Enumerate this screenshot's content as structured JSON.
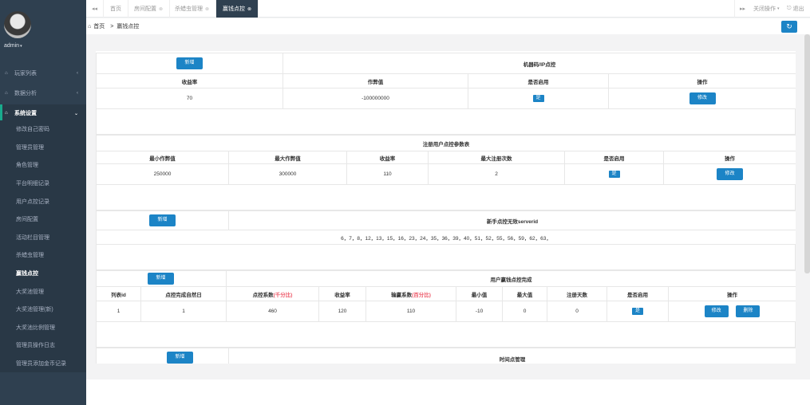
{
  "sidebar": {
    "username": "admin",
    "menus": [
      {
        "icon": "home-icon",
        "label": "玩家列表"
      },
      {
        "icon": "home-icon",
        "label": "数据分析"
      },
      {
        "icon": "home-icon",
        "label": "系统设置"
      }
    ],
    "submenu": [
      "修改自己密码",
      "管理员管理",
      "角色管理",
      "平台明细记录",
      "用户点控记录",
      "房间配置",
      "活动栏目管理",
      "杀蜡虫管理",
      "赢钱点控",
      "大奖池管理",
      "大奖池管理(新)",
      "大奖池比例管理",
      "管理员操作日志",
      "管理员添加金币记录"
    ]
  },
  "tabs": {
    "items": [
      "首页",
      "房间配置",
      "杀蜡虫管理",
      "赢钱点控"
    ],
    "close_ops": "关闭操作",
    "logout": "退出"
  },
  "breadcrumb": {
    "home": "首页",
    "sep": ">",
    "current": "赢钱点控"
  },
  "section1": {
    "add": "新增",
    "title": "机器码/IP点控",
    "headers": [
      "收益率",
      "作弊值",
      "是否启用",
      "操作"
    ],
    "row": {
      "rate": "70",
      "cheat": "-100000000",
      "enabled": "是",
      "edit": "修改"
    }
  },
  "section2": {
    "title": "注册用户点控参数表",
    "headers": [
      "最小作弊值",
      "最大作弊值",
      "收益率",
      "最大注册次数",
      "是否启用",
      "操作"
    ],
    "row": {
      "min": "250000",
      "max": "300000",
      "rate": "110",
      "max_reg": "2",
      "enabled": "是",
      "edit": "修改"
    }
  },
  "section3": {
    "add": "新增",
    "title": "新手点控无效serverid",
    "ids": "6，7，8，12，13，15，16，23，24，35，36，39，40，51，52，55，56，59，62，63，"
  },
  "section4": {
    "add": "新增",
    "title": "用户赢钱点控完成",
    "headers": {
      "id": "列表id",
      "days": "点控完成自然日",
      "ratio": "点控系数",
      "ratio_unit": "(千分比)",
      "rate": "收益率",
      "win": "输赢系数",
      "win_unit": "(百分比)",
      "min": "最小值",
      "max": "最大值",
      "reg_days": "注册天数",
      "enabled": "是否启用",
      "op": "操作"
    },
    "row": {
      "id": "1",
      "days": "1",
      "ratio": "460",
      "rate": "120",
      "win": "110",
      "min": "-10",
      "max": "0",
      "reg_days": "0",
      "enabled": "是",
      "edit": "修改",
      "delete": "删除"
    }
  },
  "section5": {
    "add": "新增",
    "title": "时间点管理"
  },
  "colors": {
    "sidebar": "#2f4050",
    "primary": "#1c84c6",
    "accent": "#19aa8d"
  }
}
